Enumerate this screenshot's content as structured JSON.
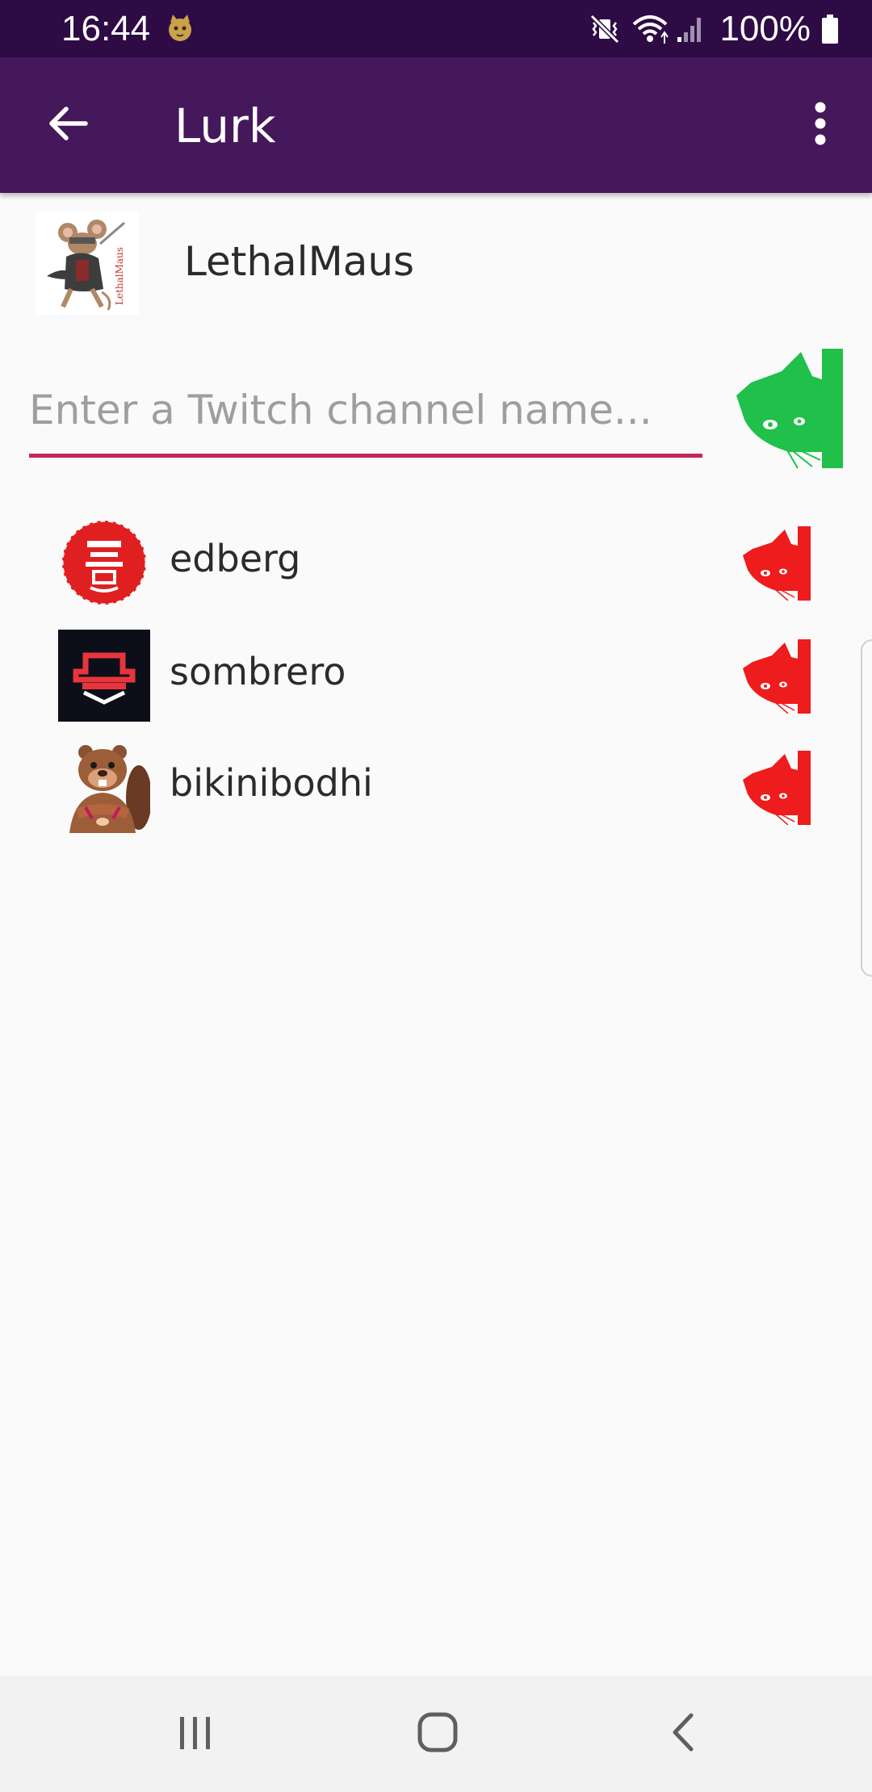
{
  "status_bar": {
    "time": "16:44",
    "battery_text": "100%",
    "icons": [
      "cat-notification-icon",
      "vibrate-mute-icon",
      "wifi-icon",
      "signal-icon",
      "battery-icon"
    ]
  },
  "app_bar": {
    "title": "Lurk",
    "back_icon": "arrow-back-icon",
    "menu_icon": "more-vert-icon"
  },
  "user": {
    "name": "LethalMaus",
    "avatar_caption": "LethalMaus"
  },
  "channel_input": {
    "value": "",
    "placeholder": "Enter a Twitch channel name...",
    "add_button_icon": "green-cat-lurk-icon"
  },
  "channels": [
    {
      "name": "edberg",
      "lurk_icon": "red-cat-unlurk-icon"
    },
    {
      "name": "sombrero",
      "lurk_icon": "red-cat-unlurk-icon"
    },
    {
      "name": "bikinibodhi",
      "lurk_icon": "red-cat-unlurk-icon"
    }
  ],
  "colors": {
    "status_bar": "#2e0b45",
    "app_bar": "#44185a",
    "accent": "#c4275e",
    "lurk_active": "#20c04a",
    "lurk_inactive": "#ee1c1c",
    "background": "#fafafa"
  },
  "nav_bar": {
    "icons": [
      "recents-icon",
      "home-icon",
      "back-nav-icon"
    ]
  }
}
